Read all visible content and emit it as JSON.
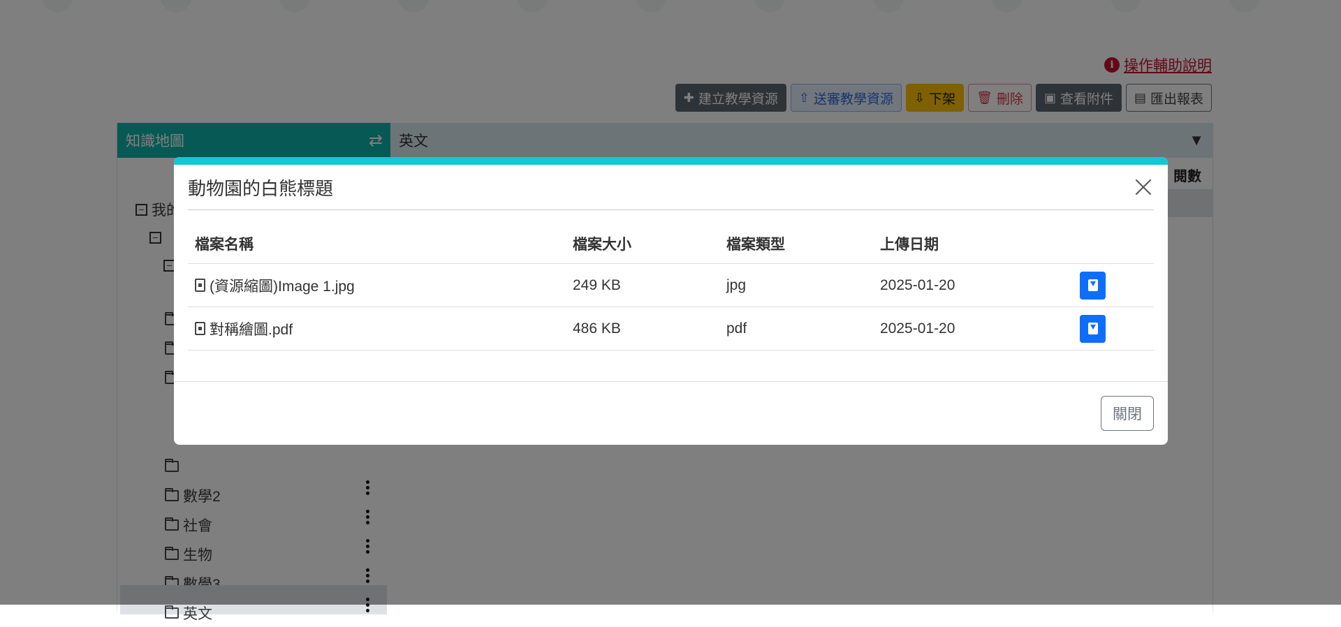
{
  "help": {
    "icon": "info-circle-icon",
    "label": "操作輔助說明"
  },
  "toolbar": {
    "create": "建立教學資源",
    "submit": "送審教學資源",
    "unlist": "下架",
    "delete": "刪除",
    "attachments": "查看附件",
    "export": "匯出報表"
  },
  "left_panel": {
    "title": "知識地圖",
    "tree": [
      {
        "label": "我的"
      },
      {
        "label": "數學2"
      },
      {
        "label": "社會"
      },
      {
        "label": "生物"
      },
      {
        "label": "數學3"
      },
      {
        "label": "英文",
        "selected": true
      }
    ]
  },
  "right_panel": {
    "title": "英文",
    "column": "閱數"
  },
  "modal": {
    "title": "動物園的白熊標題",
    "columns": [
      "檔案名稱",
      "檔案大小",
      "檔案類型",
      "上傳日期"
    ],
    "files": [
      {
        "name": "(資源縮圖)Image 1.jpg",
        "size": "249 KB",
        "type": "jpg",
        "date": "2025-01-20",
        "icon": "file-image-icon"
      },
      {
        "name": "對稱繪圖.pdf",
        "size": "486 KB",
        "type": "pdf",
        "date": "2025-01-20",
        "icon": "file-pdf-icon"
      }
    ],
    "close_label": "關閉"
  },
  "colors": {
    "accent": "#14c8d2",
    "primary": "#0d6efd",
    "panel_header": "#0fb3ab",
    "danger": "#c8102e"
  }
}
